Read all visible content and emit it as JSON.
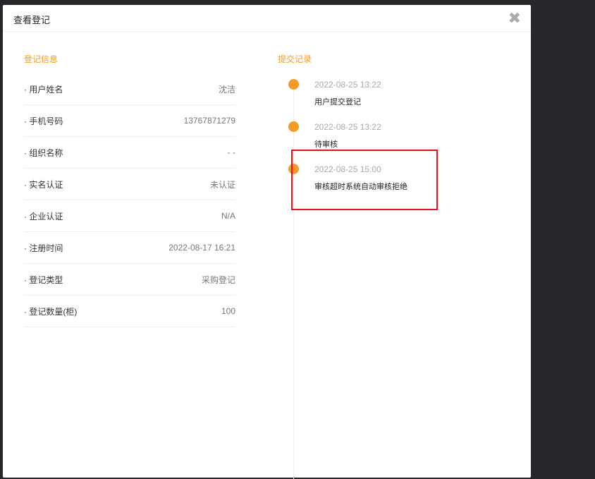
{
  "dialog": {
    "title": "查看登记",
    "close_icon": "close-icon"
  },
  "info": {
    "heading": "登记信息",
    "rows": [
      {
        "label": "· 用户姓名",
        "value": "沈洁"
      },
      {
        "label": "· 手机号码",
        "value": "13767871279"
      },
      {
        "label": "· 组织名称",
        "value": "- -"
      },
      {
        "label": "· 实名认证",
        "value": "未认证"
      },
      {
        "label": "· 企业认证",
        "value": "N/A"
      },
      {
        "label": "· 注册时间",
        "value": "2022-08-17 16:21"
      },
      {
        "label": "· 登记类型",
        "value": "采购登记"
      },
      {
        "label": "· 登记数量(柜)",
        "value": "100"
      }
    ]
  },
  "records": {
    "heading": "提交记录",
    "items": [
      {
        "time": "2022-08-25 13:22",
        "desc": "用户提交登记"
      },
      {
        "time": "2022-08-25 13:22",
        "desc": "待审核"
      },
      {
        "time": "2022-08-25 15:00",
        "desc": "审核超时系统自动审核拒绝"
      }
    ]
  },
  "colors": {
    "accent": "#f39b25",
    "highlight": "#e8101c"
  }
}
